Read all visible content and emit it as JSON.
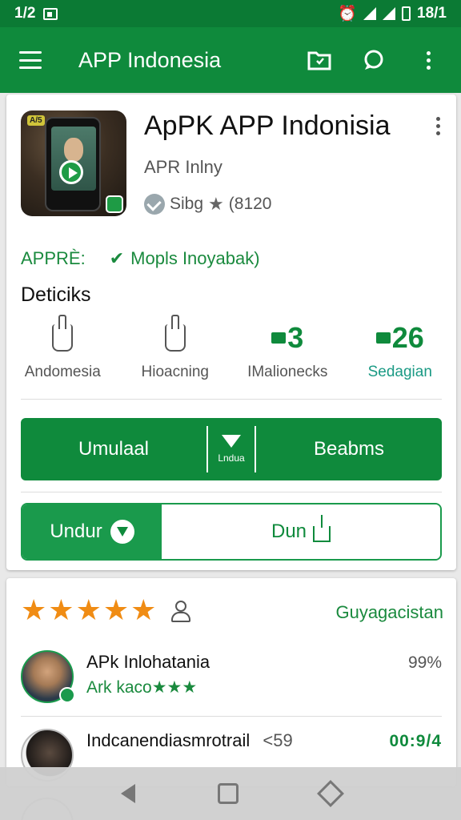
{
  "status_bar": {
    "time": "1/2",
    "clock": "18/1"
  },
  "app_bar": {
    "title": "APP Indonesia"
  },
  "app": {
    "icon_tag": "A/5",
    "name": "ApPK APP Indonisia",
    "developer": "APR Inlny",
    "rating_text": "Sibg",
    "rating_count": "(8120",
    "meta_label": "APPRÈ:",
    "meta_check": "✔",
    "meta_value": "Mopls Inoyabak)",
    "details_title": "Deticiks",
    "stats": [
      {
        "value": "",
        "label": "Andomesia",
        "icon": "hand-icon"
      },
      {
        "value": "",
        "label": "Hioacning",
        "icon": "hand-icon"
      },
      {
        "value": "3",
        "label": "IMalionecks",
        "icon": "download-count-icon"
      },
      {
        "value": "26",
        "label": "Sedagian",
        "icon": "size-icon"
      }
    ],
    "primary_left": "Umulaal",
    "primary_mid": "Lndua",
    "primary_right": "Beabms",
    "split_left": "Undur",
    "split_right": "Dun"
  },
  "reviews": {
    "star_count": 5,
    "link": "Guyagacistan",
    "items": [
      {
        "name": "APk Inlohatania",
        "sub": "Ark kaco",
        "sub_stars": "★★★",
        "right": "99%"
      },
      {
        "name": "Indcanendiasmrotrail",
        "right_mid": "<59",
        "right": "00:9/4"
      }
    ]
  },
  "colors": {
    "brand_green": "#0f8a3c",
    "status_green": "#0b7a34",
    "star_orange": "#f08c14"
  }
}
